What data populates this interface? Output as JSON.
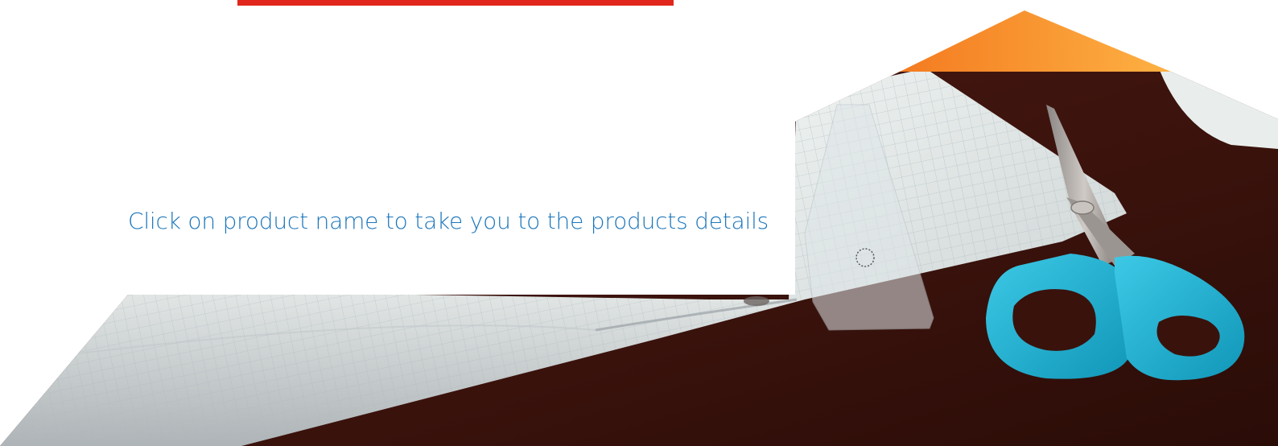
{
  "caption": {
    "text": "Click on product name to take you to the products details"
  },
  "colors": {
    "accent_bar": "#e1261c",
    "caption_text": "#1c76bb",
    "triangle_start": "#f47b20",
    "triangle_end": "#fdb143",
    "desk": "#3a120c",
    "scissors_handle": "#22b6d6"
  },
  "photo": {
    "subject": "scissors-ruler-notebook-on-desk"
  }
}
